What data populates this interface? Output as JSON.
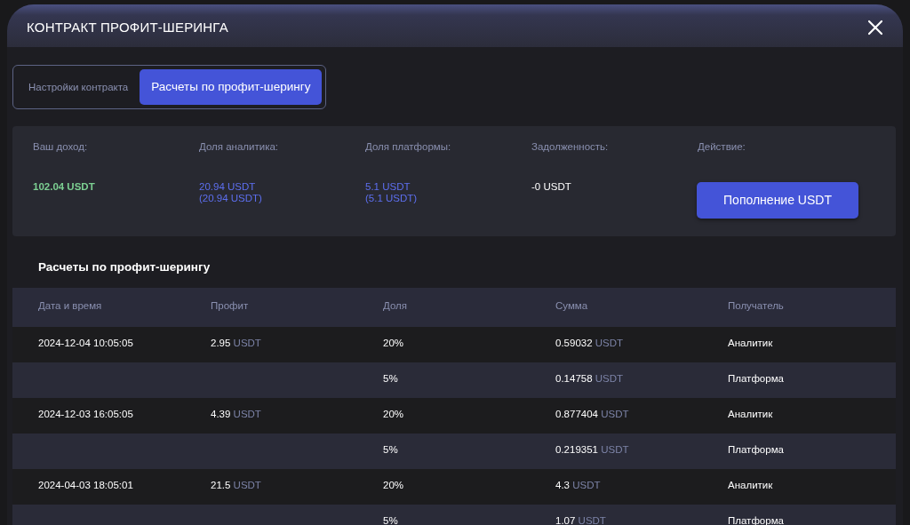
{
  "window": {
    "title": "КОНТРАКТ ПРОФИТ-ШЕРИНГА"
  },
  "tabs": [
    {
      "label": "Настройки контракта",
      "selected": false
    },
    {
      "label": "Расчеты по профит-шерингу",
      "selected": true
    }
  ],
  "summary": {
    "items": [
      {
        "label": "Ваш доход:",
        "kind": "income",
        "lines": [
          "102.04 USDT"
        ]
      },
      {
        "label": "Доля аналитика:",
        "kind": "share",
        "lines": [
          "20.94 USDT",
          "(20.94 USDT)"
        ]
      },
      {
        "label": "Доля платформы:",
        "kind": "share",
        "lines": [
          "5.1 USDT",
          "(5.1 USDT)"
        ]
      },
      {
        "label": "Задолженность:",
        "kind": "plain",
        "lines": [
          "-0 USDT"
        ]
      }
    ],
    "action": {
      "label": "Действие:",
      "button": "Пополнение USDT"
    }
  },
  "section_title": "Расчеты по профит-шерингу",
  "table": {
    "columns": [
      "Дата и время",
      "Профит",
      "Доля",
      "Сумма",
      "Получатель"
    ],
    "rows": [
      {
        "datetime": "2024-12-04 10:05:05",
        "profit": {
          "value": "2.95",
          "unit": "USDT"
        },
        "share": "20%",
        "amount": {
          "value": "0.59032",
          "unit": "USDT"
        },
        "recipient": "Аналитик"
      },
      {
        "share": "5%",
        "amount": {
          "value": "0.14758",
          "unit": "USDT"
        },
        "recipient": "Платформа"
      },
      {
        "datetime": "2024-12-03 16:05:05",
        "profit": {
          "value": "4.39",
          "unit": "USDT"
        },
        "share": "20%",
        "amount": {
          "value": "0.877404",
          "unit": "USDT"
        },
        "recipient": "Аналитик"
      },
      {
        "share": "5%",
        "amount": {
          "value": "0.219351",
          "unit": "USDT"
        },
        "recipient": "Платформа"
      },
      {
        "datetime": "2024-04-03 18:05:01",
        "profit": {
          "value": "21.5",
          "unit": "USDT"
        },
        "share": "20%",
        "amount": {
          "value": "4.3",
          "unit": "USDT"
        },
        "recipient": "Аналитик"
      },
      {
        "share": "5%",
        "amount": {
          "value": "1.07",
          "unit": "USDT"
        },
        "recipient": "Платформа"
      }
    ]
  }
}
